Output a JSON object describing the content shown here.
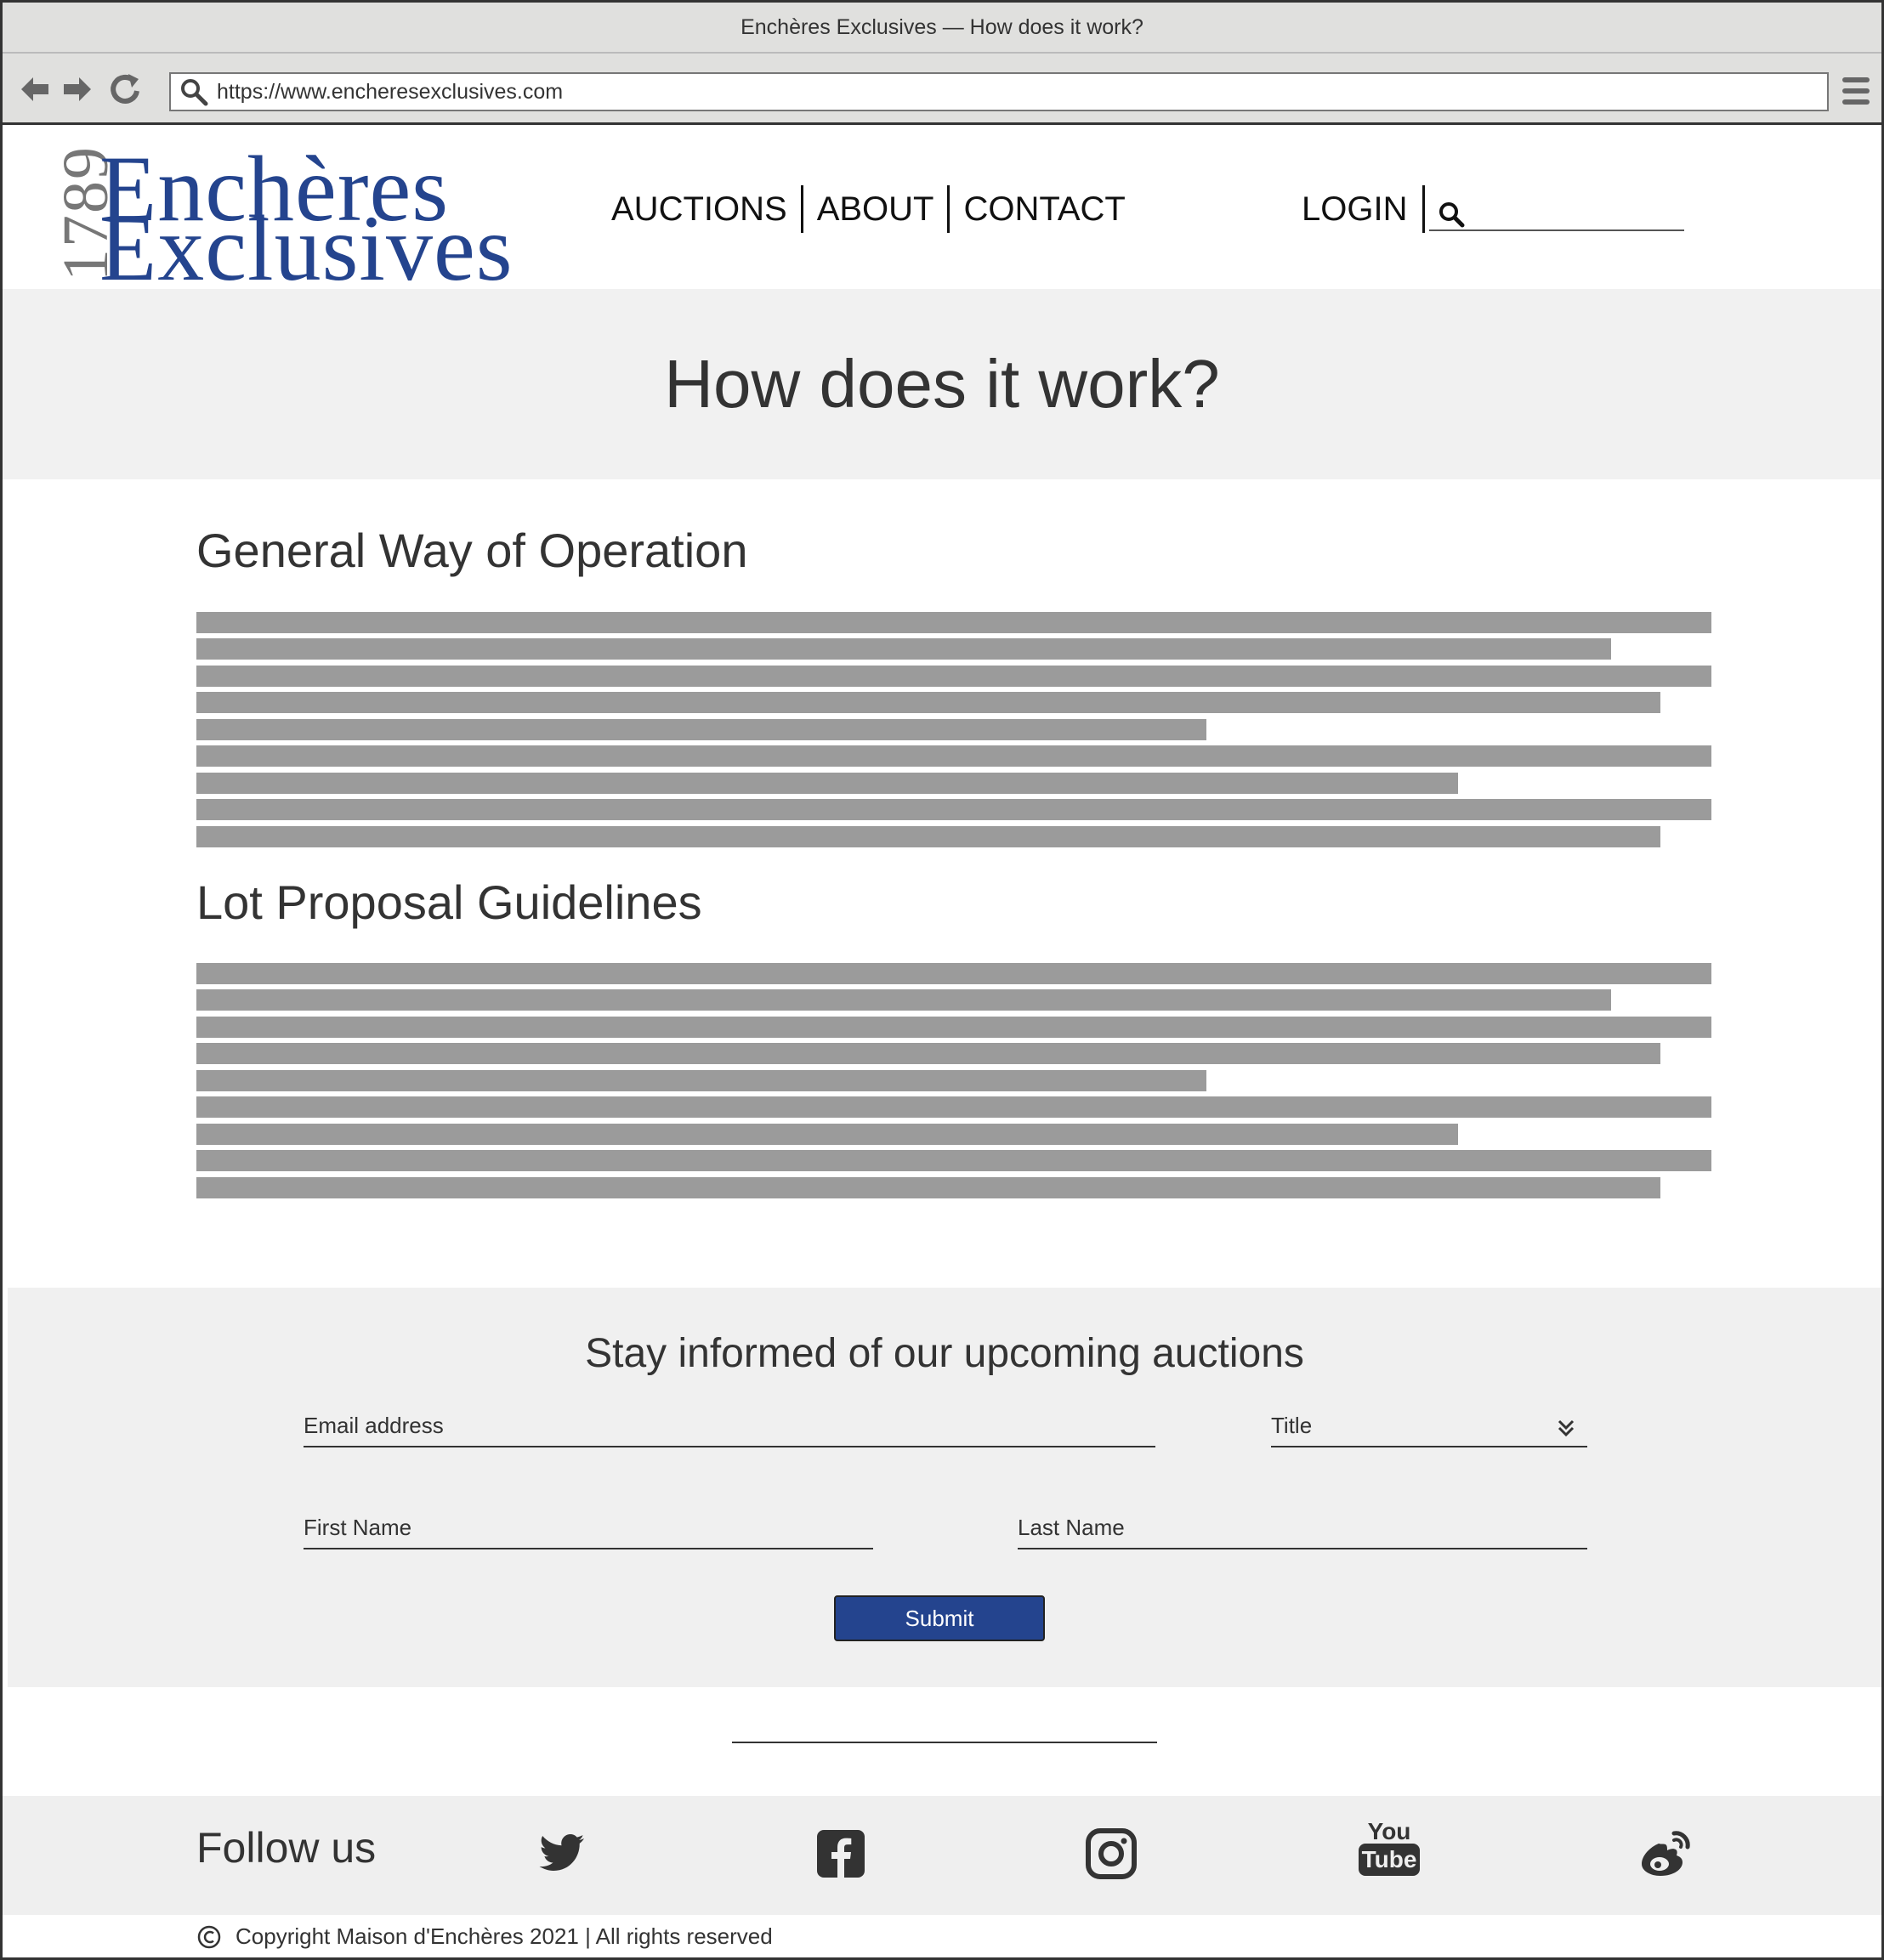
{
  "browser": {
    "title": "Enchères Exclusives — How does it work?",
    "url": "https://www.encheresexclusives.com"
  },
  "logo": {
    "year": "1789",
    "line1": "Enchères",
    "line2": "Exclusives",
    "brand_color": "#24448e"
  },
  "nav": {
    "auctions": "AUCTIONS",
    "about": "ABOUT",
    "contact": "CONTACT",
    "login": "LOGIN"
  },
  "hero": {
    "title": "How does it work?"
  },
  "sections": [
    {
      "title": "General Way of Operation"
    },
    {
      "title": "Lot Proposal Guidelines"
    }
  ],
  "newsletter": {
    "title": "Stay informed of our upcoming auctions",
    "email_label": "Email address",
    "title_label": "Title",
    "first_name_label": "First Name",
    "last_name_label": "Last Name",
    "submit_label": "Submit"
  },
  "footer": {
    "follow_label": "Follow us",
    "social_icons": [
      "twitter-icon",
      "facebook-icon",
      "instagram-icon",
      "youtube-icon",
      "weibo-icon"
    ],
    "youtube_you": "You",
    "youtube_tube": "Tube",
    "copyright": "Copyright Maison d'Enchères 2021 | All rights reserved"
  }
}
